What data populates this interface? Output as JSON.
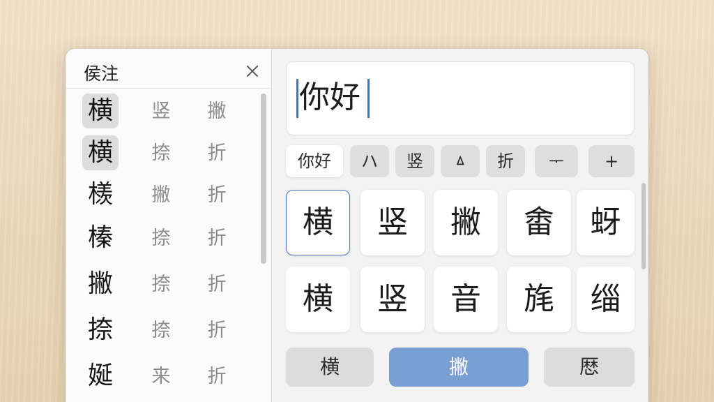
{
  "left_panel": {
    "title": "侯注",
    "candidates": [
      {
        "main": "横",
        "alt1": "竖",
        "alt2": "撇",
        "selected": true
      },
      {
        "main": "横",
        "alt1": "捺",
        "alt2": "折",
        "selected": true
      },
      {
        "main": "檨",
        "alt1": "撇",
        "alt2": "折",
        "selected": false
      },
      {
        "main": "榛",
        "alt1": "捺",
        "alt2": "折",
        "selected": false
      },
      {
        "main": "撇",
        "alt1": "捺",
        "alt2": "折",
        "selected": false
      },
      {
        "main": "捺",
        "alt1": "捺",
        "alt2": "折",
        "selected": false
      },
      {
        "main": "娫",
        "alt1": "来",
        "alt2": "折",
        "selected": false
      }
    ]
  },
  "input": {
    "text": "你好"
  },
  "stroke_bar": [
    {
      "label": "你好",
      "active": true
    },
    {
      "label": "ハ",
      "active": false
    },
    {
      "label": "竖",
      "active": false
    },
    {
      "label": "ㅿ",
      "active": false
    },
    {
      "label": "折",
      "active": false
    },
    {
      "label": "ᅮ",
      "active": false
    },
    {
      "label": "+",
      "active": false
    }
  ],
  "grid": [
    {
      "char": "横",
      "selected": true
    },
    {
      "char": "竖",
      "selected": false
    },
    {
      "char": "撇",
      "selected": false
    },
    {
      "char": "畬",
      "selected": false
    },
    {
      "char": "蚜",
      "selected": false
    },
    {
      "char": "横",
      "selected": false
    },
    {
      "char": "竖",
      "selected": false
    },
    {
      "char": "音",
      "selected": false
    },
    {
      "char": "旄",
      "selected": false
    },
    {
      "char": "缁",
      "selected": false
    }
  ],
  "bottom_buttons": {
    "left": "横",
    "middle": "撇",
    "right": "厯"
  },
  "colors": {
    "accent": "#7a9fd3",
    "cursor": "#3d6fc4",
    "selected_border": "#4a78c0"
  }
}
